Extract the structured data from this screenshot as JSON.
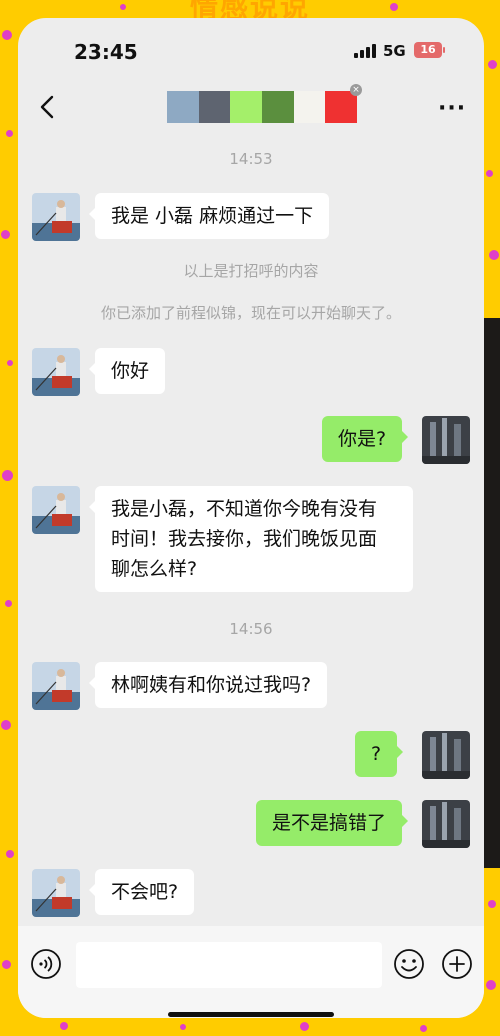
{
  "watermark": "情感说说",
  "status": {
    "time": "23:45",
    "network": "5G",
    "battery": "16"
  },
  "nav": {
    "title_colors": [
      "#8ea9c3",
      "#5e6470",
      "#a4ef6a",
      "#5b8f3e",
      "#f4f3ee",
      "#ef3131"
    ],
    "badge": "×",
    "more": "···"
  },
  "chat": {
    "ts1": "14:53",
    "m1": "我是 小磊 麻烦通过一下",
    "sys1": "以上是打招呼的内容",
    "sys2": "你已添加了前程似锦，现在可以开始聊天了。",
    "m2": "你好",
    "m3": "你是?",
    "m4_l1": "我是小磊，不知道你今晚有没有",
    "m4_l2": "时间！我去接你，我们晚饭见面",
    "m4_l3": "聊怎么样?",
    "ts2": "14:56",
    "m5": "林啊姨有和你说过我吗?",
    "m6": "?",
    "m7": "是不是搞错了",
    "m8": "不会吧?"
  },
  "colors": {
    "incoming": "#ffffff",
    "outgoing": "#95ec69",
    "background": "#ededed",
    "frame": "#ffcc00"
  },
  "icons": [
    "back-icon",
    "voice-icon",
    "emoji-icon",
    "plus-icon",
    "signal-icon",
    "battery-icon"
  ]
}
